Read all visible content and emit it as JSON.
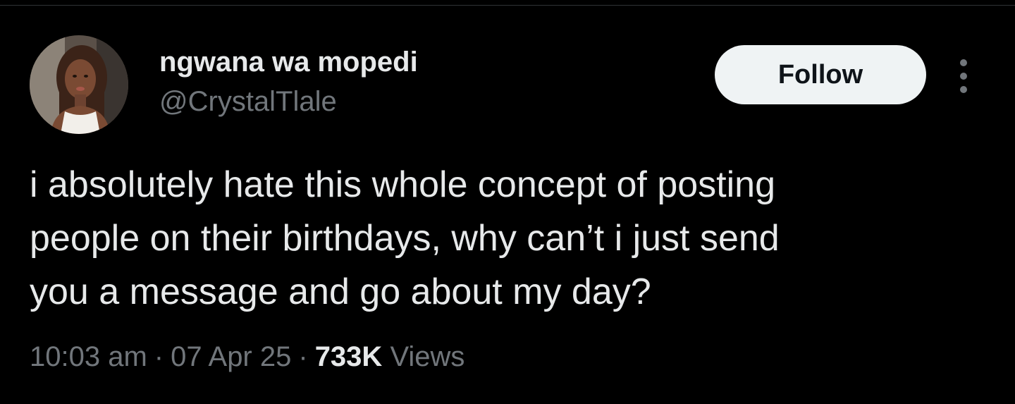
{
  "tweet": {
    "author": {
      "display_name": "ngwana wa mopedi",
      "handle": "@CrystalTlale",
      "avatar": "profile-photo"
    },
    "follow_label": "Follow",
    "more_icon": "vertical-ellipsis-icon",
    "text_lines": [
      "i absolutely hate this whole concept of posting",
      "people on their birthdays, why can’t i just send",
      "you a message and go about my day?"
    ],
    "time": "10:03 am",
    "date": "07 Apr 25",
    "separator": "·",
    "views_count": "733K",
    "views_label": "Views"
  },
  "colors": {
    "background": "#000000",
    "primary_text": "#e7e9ea",
    "secondary_text": "#71767b",
    "button_bg": "#eff3f4",
    "button_text": "#0f1419"
  }
}
